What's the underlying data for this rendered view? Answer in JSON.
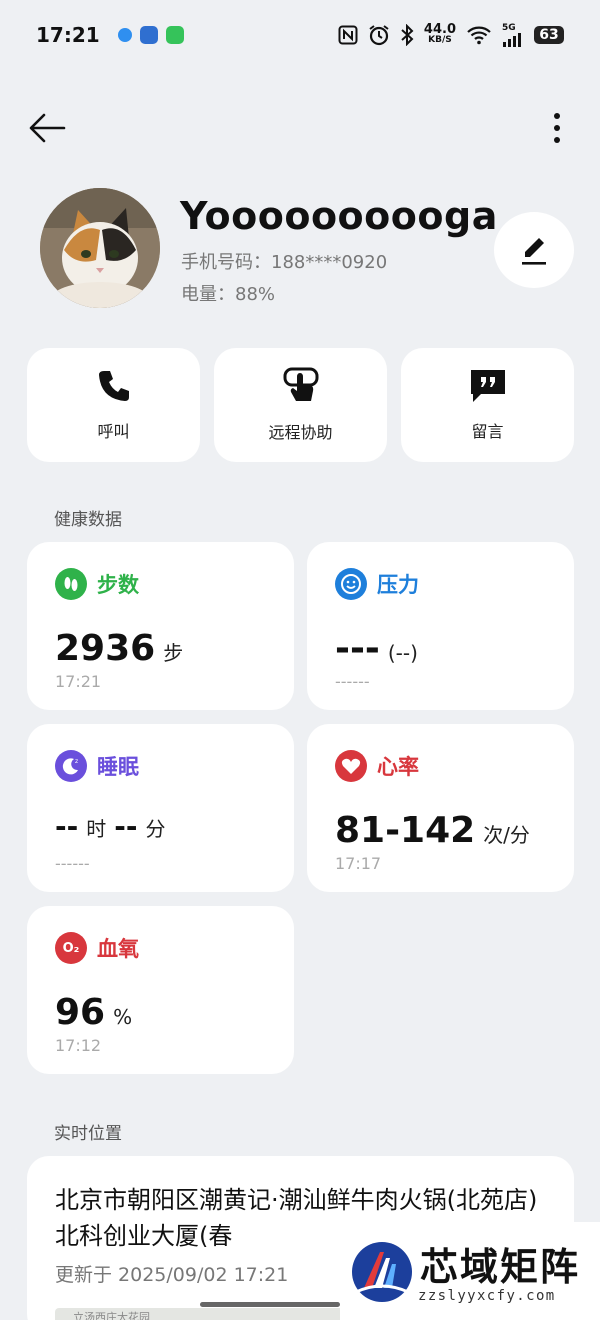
{
  "status_bar": {
    "time": "17:21",
    "net_speed_value": "44.0",
    "net_speed_unit": "KB/S",
    "network": "5G",
    "battery": "63",
    "icons": [
      "nfc-icon",
      "alarm-icon",
      "bluetooth-icon",
      "wifi-icon",
      "signal-icon"
    ]
  },
  "profile": {
    "name": "Yoooooooooga",
    "phone": "手机号码：188****0920",
    "battery": "电量：88%"
  },
  "actions": [
    {
      "label": "呼叫",
      "icon": "phone-icon"
    },
    {
      "label": "远程协助",
      "icon": "touch-hand-icon"
    },
    {
      "label": "留言",
      "icon": "message-quote-icon"
    }
  ],
  "health": {
    "section_title": "健康数据",
    "steps": {
      "title": "步数",
      "value": "2936",
      "unit": "步",
      "time": "17:21",
      "color": "#2fb24a"
    },
    "stress": {
      "title": "压力",
      "value": "---",
      "unit": "(--)",
      "time": "------",
      "color": "#1e7fdb"
    },
    "sleep": {
      "title": "睡眠",
      "value1": "--",
      "unit1": "时",
      "value2": "--",
      "unit2": "分",
      "time": "------",
      "color": "#6a4fdc"
    },
    "heart": {
      "title": "心率",
      "value": "81-142",
      "unit": "次/分",
      "time": "17:17",
      "color": "#d8373d"
    },
    "oxygen": {
      "title": "血氧",
      "value": "96",
      "unit": "%",
      "time": "17:12",
      "color": "#d8373d",
      "badge": "O₂"
    }
  },
  "location": {
    "section_title": "实时位置",
    "address": "北京市朝阳区潮黄记·潮汕鲜牛肉火锅(北苑店)北科创业大厦(春",
    "updated": "更新于 2025/09/02 17:21",
    "map_text": "立汤西庄大花园"
  },
  "watermark": {
    "title": "芯域矩阵",
    "url": "zzslyyxcfy.com"
  }
}
